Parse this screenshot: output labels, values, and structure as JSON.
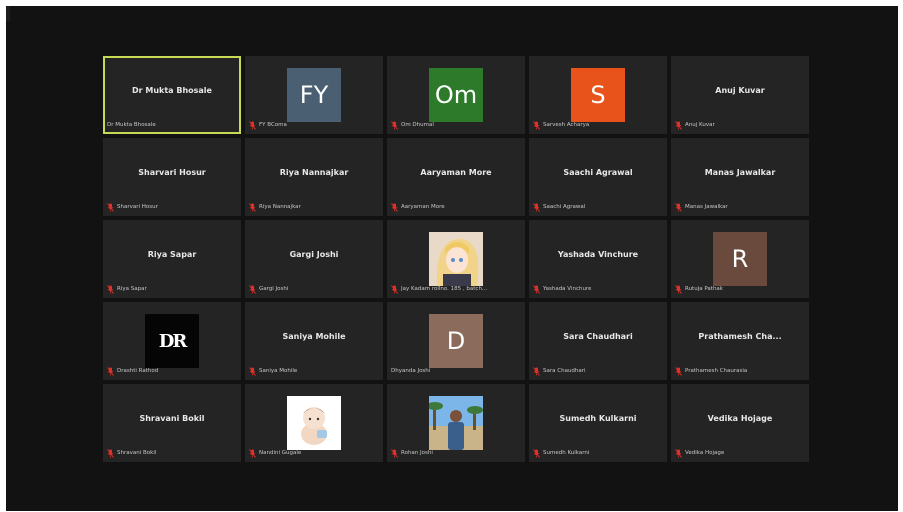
{
  "participants": [
    {
      "display": "Dr Mukta Bhosale",
      "label": "Dr Mukta Bhosale",
      "muted": false,
      "active": true
    },
    {
      "display": "",
      "label": "FY BComa",
      "muted": true,
      "avatar": {
        "kind": "initials",
        "text": "FY",
        "color": "#4a6072"
      }
    },
    {
      "display": "",
      "label": "Om Dhumal",
      "muted": true,
      "avatar": {
        "kind": "initials",
        "text": "Om",
        "color": "#2c7a2a"
      }
    },
    {
      "display": "",
      "label": "Sarvesh Acharya",
      "muted": true,
      "avatar": {
        "kind": "initials",
        "text": "S",
        "color": "#e8531c"
      }
    },
    {
      "display": "Anuj Kuvar",
      "label": "Anuj Kuvar",
      "muted": true
    },
    {
      "display": "Sharvari Hosur",
      "label": "Sharvari Hosur",
      "muted": true
    },
    {
      "display": "Riya Nannajkar",
      "label": "Riya Nannajkar",
      "muted": true
    },
    {
      "display": "Aaryaman More",
      "label": "Aaryaman More",
      "muted": true
    },
    {
      "display": "Saachi Agrawal",
      "label": "Saachi Agrawal",
      "muted": true
    },
    {
      "display": "Manas Jawalkar",
      "label": "Manas Jawalkar",
      "muted": true
    },
    {
      "display": "Riya Sapar",
      "label": "Riya Sapar",
      "muted": true
    },
    {
      "display": "Gargi Joshi",
      "label": "Gargi Joshi",
      "muted": true
    },
    {
      "display": "",
      "label": "Jay Kadam rollno. 185 , batch...",
      "muted": true,
      "avatar": {
        "kind": "anime-photo"
      }
    },
    {
      "display": "Yashada Vinchure",
      "label": "Yashada Vinchure",
      "muted": true
    },
    {
      "display": "",
      "label": "Rutuja Pathak",
      "muted": true,
      "avatar": {
        "kind": "initials",
        "text": "R",
        "color": "#6a4a3c"
      }
    },
    {
      "display": "",
      "label": "Drashti Rathod",
      "muted": true,
      "avatar": {
        "kind": "monogram",
        "text": "DR",
        "color": "#050505"
      }
    },
    {
      "display": "Saniya Mohile",
      "label": "Saniya Mohile",
      "muted": true
    },
    {
      "display": "",
      "label": "Dhyanda Joshi",
      "muted": false,
      "avatar": {
        "kind": "initials",
        "text": "D",
        "color": "#8a6b5c"
      }
    },
    {
      "display": "Sara Chaudhari",
      "label": "Sara Chaudhari",
      "muted": true
    },
    {
      "display": "Prathamesh  Cha...",
      "label": "Prathamesh Chaurasia",
      "muted": true
    },
    {
      "display": "Shravani Bokil",
      "label": "Shravani Bokil",
      "muted": true
    },
    {
      "display": "",
      "label": "Nandini Gugale",
      "muted": true,
      "avatar": {
        "kind": "cartoon-photo"
      }
    },
    {
      "display": "",
      "label": "Rohan Joshi",
      "muted": true,
      "avatar": {
        "kind": "outdoor-photo"
      }
    },
    {
      "display": "Sumedh Kulkarni",
      "label": "Sumedh Kulkarni",
      "muted": true
    },
    {
      "display": "Vedika Hojage",
      "label": "Vedika Hojage",
      "muted": true
    }
  ],
  "icons": {
    "muted": "muted-mic-icon",
    "mute_color": "#e0312a"
  }
}
